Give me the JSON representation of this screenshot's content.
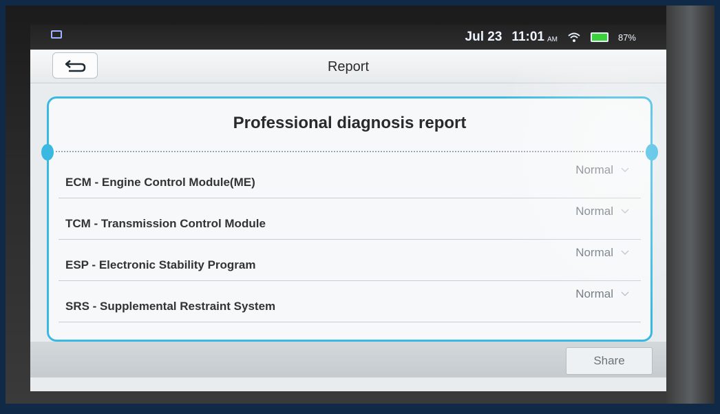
{
  "status_bar": {
    "left_text": "",
    "date": "Jul 23",
    "time": "11:01",
    "ampm": "AM",
    "battery": "87%"
  },
  "header": {
    "title": "Report"
  },
  "report": {
    "title": "Professional diagnosis report",
    "modules": [
      {
        "name": "ECM - Engine Control Module(ME)",
        "status": "Normal"
      },
      {
        "name": "TCM - Transmission Control Module",
        "status": "Normal"
      },
      {
        "name": "ESP - Electronic Stability Program",
        "status": "Normal"
      },
      {
        "name": "SRS - Supplemental Restraint System",
        "status": "Normal"
      }
    ]
  },
  "footer": {
    "share_label": "Share"
  },
  "colors": {
    "accent": "#39b8e2",
    "battery": "#3ad13a"
  },
  "icons": {
    "back": "back-arrow-icon",
    "wifi": "wifi-icon",
    "battery": "battery-icon",
    "chevron": "chevron-down-icon"
  }
}
